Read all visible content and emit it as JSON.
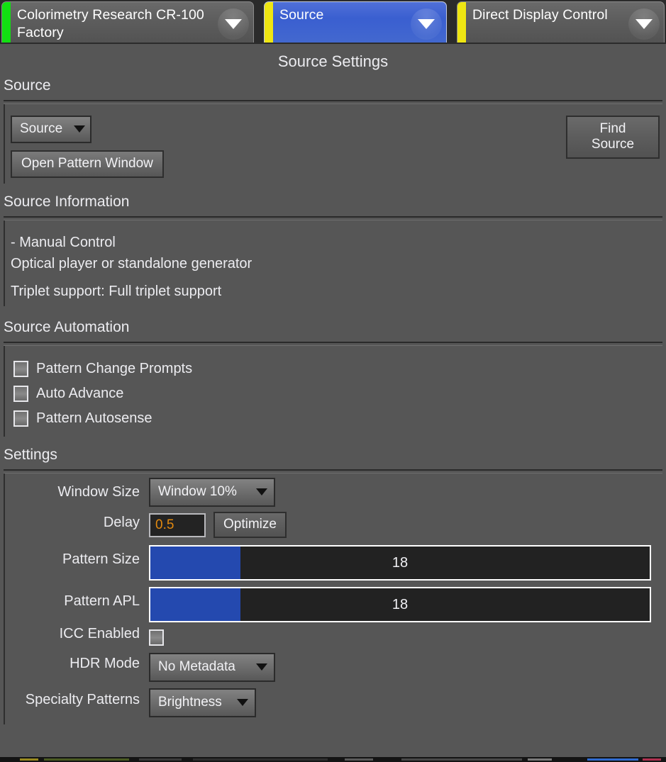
{
  "window": {
    "title": "Source Settings"
  },
  "tabs": [
    {
      "label": "Colorimetry Research CR-100\nFactory",
      "edge_color": "#12e012",
      "active": false,
      "arrow_icon": "chevron-down-icon"
    },
    {
      "label": "Source",
      "edge_color": "#efe612",
      "active": true,
      "arrow_icon": "chevron-down-icon"
    },
    {
      "label": "Direct Display Control",
      "edge_color": "#efe612",
      "active": false,
      "arrow_icon": "chevron-down-icon"
    }
  ],
  "sections": {
    "source": {
      "heading": "Source",
      "source_dropdown_value": "Source",
      "find_source_label": "Find Source",
      "open_pattern_window_label": "Open Pattern Window"
    },
    "source_information": {
      "heading": "Source Information",
      "lines": [
        "- Manual Control",
        "Optical player or standalone generator",
        "Triplet support: Full triplet support"
      ]
    },
    "source_automation": {
      "heading": "Source Automation",
      "checkboxes": [
        {
          "label": "Pattern Change Prompts",
          "checked": false
        },
        {
          "label": "Auto Advance",
          "checked": false
        },
        {
          "label": "Pattern Autosense",
          "checked": false
        }
      ]
    },
    "settings": {
      "heading": "Settings",
      "window_size": {
        "label": "Window Size",
        "value": "Window 10%"
      },
      "delay": {
        "label": "Delay",
        "value": "0.5",
        "optimize_label": "Optimize"
      },
      "pattern_size": {
        "label": "Pattern Size",
        "value": "18",
        "fill_percent": 18
      },
      "pattern_apl": {
        "label": "Pattern APL",
        "value": "18",
        "fill_percent": 18
      },
      "icc_enabled": {
        "label": "ICC Enabled",
        "checked": false
      },
      "hdr_mode": {
        "label": "HDR Mode",
        "value": "No Metadata"
      },
      "specialty_patterns": {
        "label": "Specialty Patterns",
        "value": "Brightness"
      }
    }
  },
  "colors": {
    "background": "#565656",
    "accent_blue": "#2449af",
    "tab_active_blue": "#3a5fd0",
    "value_orange": "#e2890f",
    "tab_edge_green": "#12e012",
    "tab_edge_yellow": "#efe612"
  }
}
